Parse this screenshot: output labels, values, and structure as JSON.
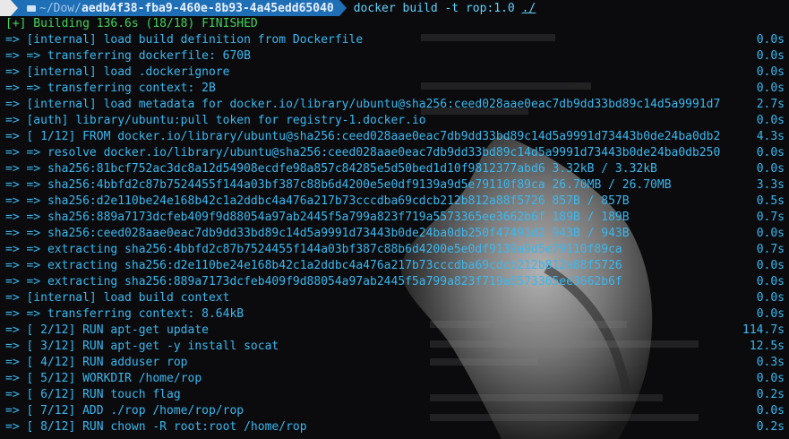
{
  "prompt": {
    "apple_glyph": "",
    "path_prefix": "~/Dow/",
    "path_dir": "aedb4f38-fba9-460e-8b93-4a45edd65040",
    "command": "docker build -t rop:1.0 ",
    "command_arg": "./"
  },
  "status_line": "[+] Building 136.6s (18/18) FINISHED",
  "lines": [
    {
      "text": "=> [internal] load build definition from Dockerfile",
      "time": "0.0s"
    },
    {
      "text": "=> => transferring dockerfile: 670B",
      "time": "0.0s"
    },
    {
      "text": "=> [internal] load .dockerignore",
      "time": "0.0s"
    },
    {
      "text": "=> => transferring context: 2B",
      "time": "0.0s"
    },
    {
      "text": "=> [internal] load metadata for docker.io/library/ubuntu@sha256:ceed028aae0eac7db9dd33bd89c14d5a9991d7",
      "time": "2.7s"
    },
    {
      "text": "=> [auth] library/ubuntu:pull token for registry-1.docker.io",
      "time": "0.0s"
    },
    {
      "text": "=> [ 1/12] FROM docker.io/library/ubuntu@sha256:ceed028aae0eac7db9dd33bd89c14d5a9991d73443b0de24ba0db2",
      "time": "4.3s"
    },
    {
      "text": "=> => resolve docker.io/library/ubuntu@sha256:ceed028aae0eac7db9dd33bd89c14d5a9991d73443b0de24ba0db250",
      "time": "0.0s"
    },
    {
      "text": "=> => sha256:81bcf752ac3dc8a12d54908ecdfe98a857c84285e5d50bed1d10f9812377abd6 3.32kB / 3.32kB",
      "time": "0.0s"
    },
    {
      "text": "=> => sha256:4bbfd2c87b7524455f144a03bf387c88b6d4200e5e0df9139a9d5e79110f89ca 26.70MB / 26.70MB",
      "time": "3.3s"
    },
    {
      "text": "=> => sha256:d2e110be24e168b42c1a2ddbc4a476a217b73cccdba69cdcb212b812a88f5726 857B / 857B",
      "time": "0.5s"
    },
    {
      "text": "=> => sha256:889a7173dcfeb409f9d88054a97ab2445f5a799a823f719a5573365ee3662b6f 189B / 189B",
      "time": "0.7s"
    },
    {
      "text": "=> => sha256:ceed028aae0eac7db9dd33bd89c14d5a9991d73443b0de24ba0db250f47491d2 943B / 943B",
      "time": "0.0s"
    },
    {
      "text": "=> => extracting sha256:4bbfd2c87b7524455f144a03bf387c88b6d4200e5e0df9139a9d5e79110f89ca",
      "time": "0.7s"
    },
    {
      "text": "=> => extracting sha256:d2e110be24e168b42c1a2ddbc4a476a217b73cccdba69cdcb212b812a88f5726",
      "time": "0.0s"
    },
    {
      "text": "=> => extracting sha256:889a7173dcfeb409f9d88054a97ab2445f5a799a823f719a5573365ee3662b6f",
      "time": "0.0s"
    },
    {
      "text": "=> [internal] load build context",
      "time": "0.0s"
    },
    {
      "text": "=> => transferring context: 8.64kB",
      "time": "0.0s"
    },
    {
      "text": "=> [ 2/12] RUN apt-get update",
      "time": "114.7s"
    },
    {
      "text": "=> [ 3/12] RUN apt-get -y install socat",
      "time": "12.5s"
    },
    {
      "text": "=> [ 4/12] RUN adduser rop",
      "time": "0.3s"
    },
    {
      "text": "=> [ 5/12] WORKDIR /home/rop",
      "time": "0.0s"
    },
    {
      "text": "=> [ 6/12] RUN touch flag",
      "time": "0.2s"
    },
    {
      "text": "=> [ 7/12] ADD ./rop /home/rop/rop",
      "time": "0.0s"
    },
    {
      "text": "=> [ 8/12] RUN chown -R root:root /home/rop",
      "time": "0.2s"
    }
  ],
  "colors": {
    "text": "#39b8f0",
    "finished": "#42d35a",
    "path_segment": "#1f6fb6",
    "apple_segment": "#e8e8e8"
  }
}
